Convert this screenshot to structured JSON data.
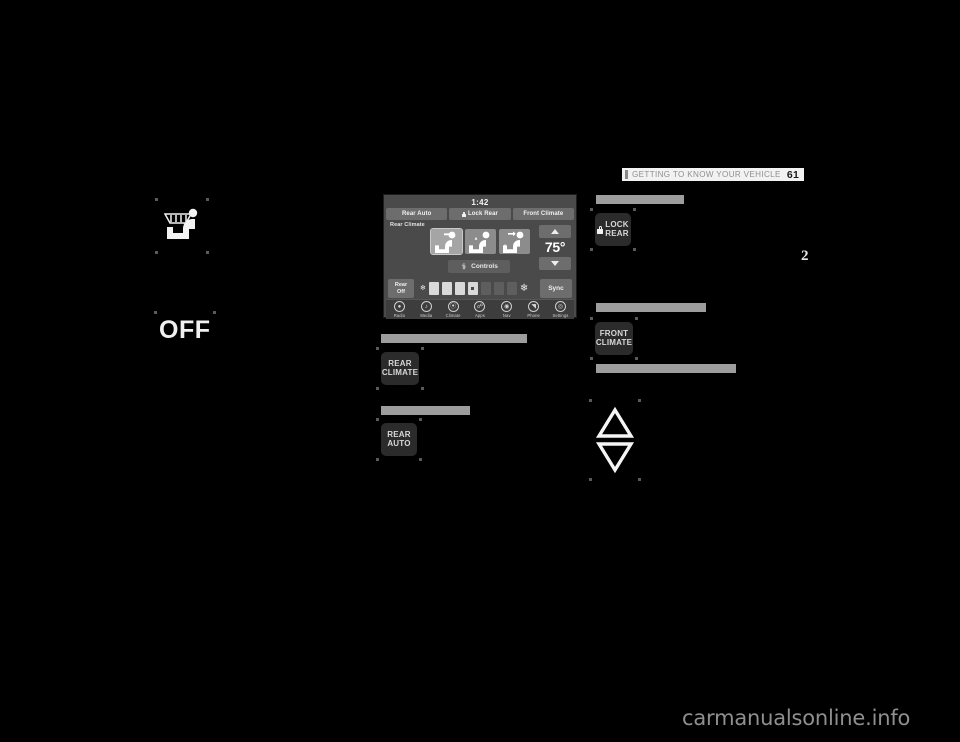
{
  "header": {
    "title": "GETTING TO KNOW YOUR VEHICLE",
    "page_number": "61",
    "chapter_tab": "2"
  },
  "left_column": {
    "defroster_icon": "rear-window-defroster-seat-icon",
    "off_label": "OFF"
  },
  "touchscreen": {
    "clock": "1:42",
    "tabs": [
      {
        "label": "Rear Auto",
        "icon": ""
      },
      {
        "label": "Lock Rear",
        "icon": "lock-icon"
      },
      {
        "label": "Front Climate",
        "icon": ""
      }
    ],
    "rear_climate_label": "Rear Climate",
    "seat_modes": [
      {
        "name": "face-airflow",
        "active": true
      },
      {
        "name": "face-and-feet-airflow",
        "active": false
      },
      {
        "name": "feet-airflow",
        "active": false
      }
    ],
    "temp_up_icon": "triangle-up-icon",
    "temp_down_icon": "triangle-down-icon",
    "temperature": "75°",
    "controls_label": "Controls",
    "controls_icon": "hand-touch-icon",
    "rear_off_label_line1": "Rear",
    "rear_off_label_line2": "Off",
    "sync_label": "Sync",
    "fan_min_icon": "small-fan-icon",
    "fan_max_icon": "large-fan-icon",
    "fan_level": 4,
    "fan_segments": 8,
    "nav_items": [
      {
        "label": "Radio",
        "icon": "radio-icon",
        "glyph": "ⓘ"
      },
      {
        "label": "Media",
        "icon": "media-note-icon",
        "glyph": "♪"
      },
      {
        "label": "Climate",
        "icon": "climate-fan-icon",
        "glyph": "◔"
      },
      {
        "label": "Apps",
        "icon": "apps-icon",
        "glyph": "Ⓤ"
      },
      {
        "label": "Nav",
        "icon": "nav-compass-icon",
        "glyph": "◉"
      },
      {
        "label": "Phone",
        "icon": "phone-icon",
        "glyph": "◥"
      },
      {
        "label": "Settings",
        "icon": "settings-gear-icon",
        "glyph": "◎"
      }
    ]
  },
  "middle_column": {
    "section_1_heading": "",
    "rear_climate_button": {
      "line1": "REAR",
      "line2": "CLIMATE"
    },
    "section_2_heading": "",
    "rear_auto_button": {
      "line1": "REAR",
      "line2": "AUTO"
    }
  },
  "right_column": {
    "section_1_heading": "",
    "lock_rear_button": {
      "line1": "LOCK",
      "line2": "REAR",
      "icon": "lock-icon"
    },
    "section_2_heading": "",
    "front_climate_button": {
      "line1": "FRONT",
      "line2": "CLIMATE"
    },
    "section_3_heading": "",
    "temp_up_icon": "triangle-up-icon",
    "temp_down_icon": "triangle-down-icon"
  },
  "watermark": "carmanualsonline.info"
}
